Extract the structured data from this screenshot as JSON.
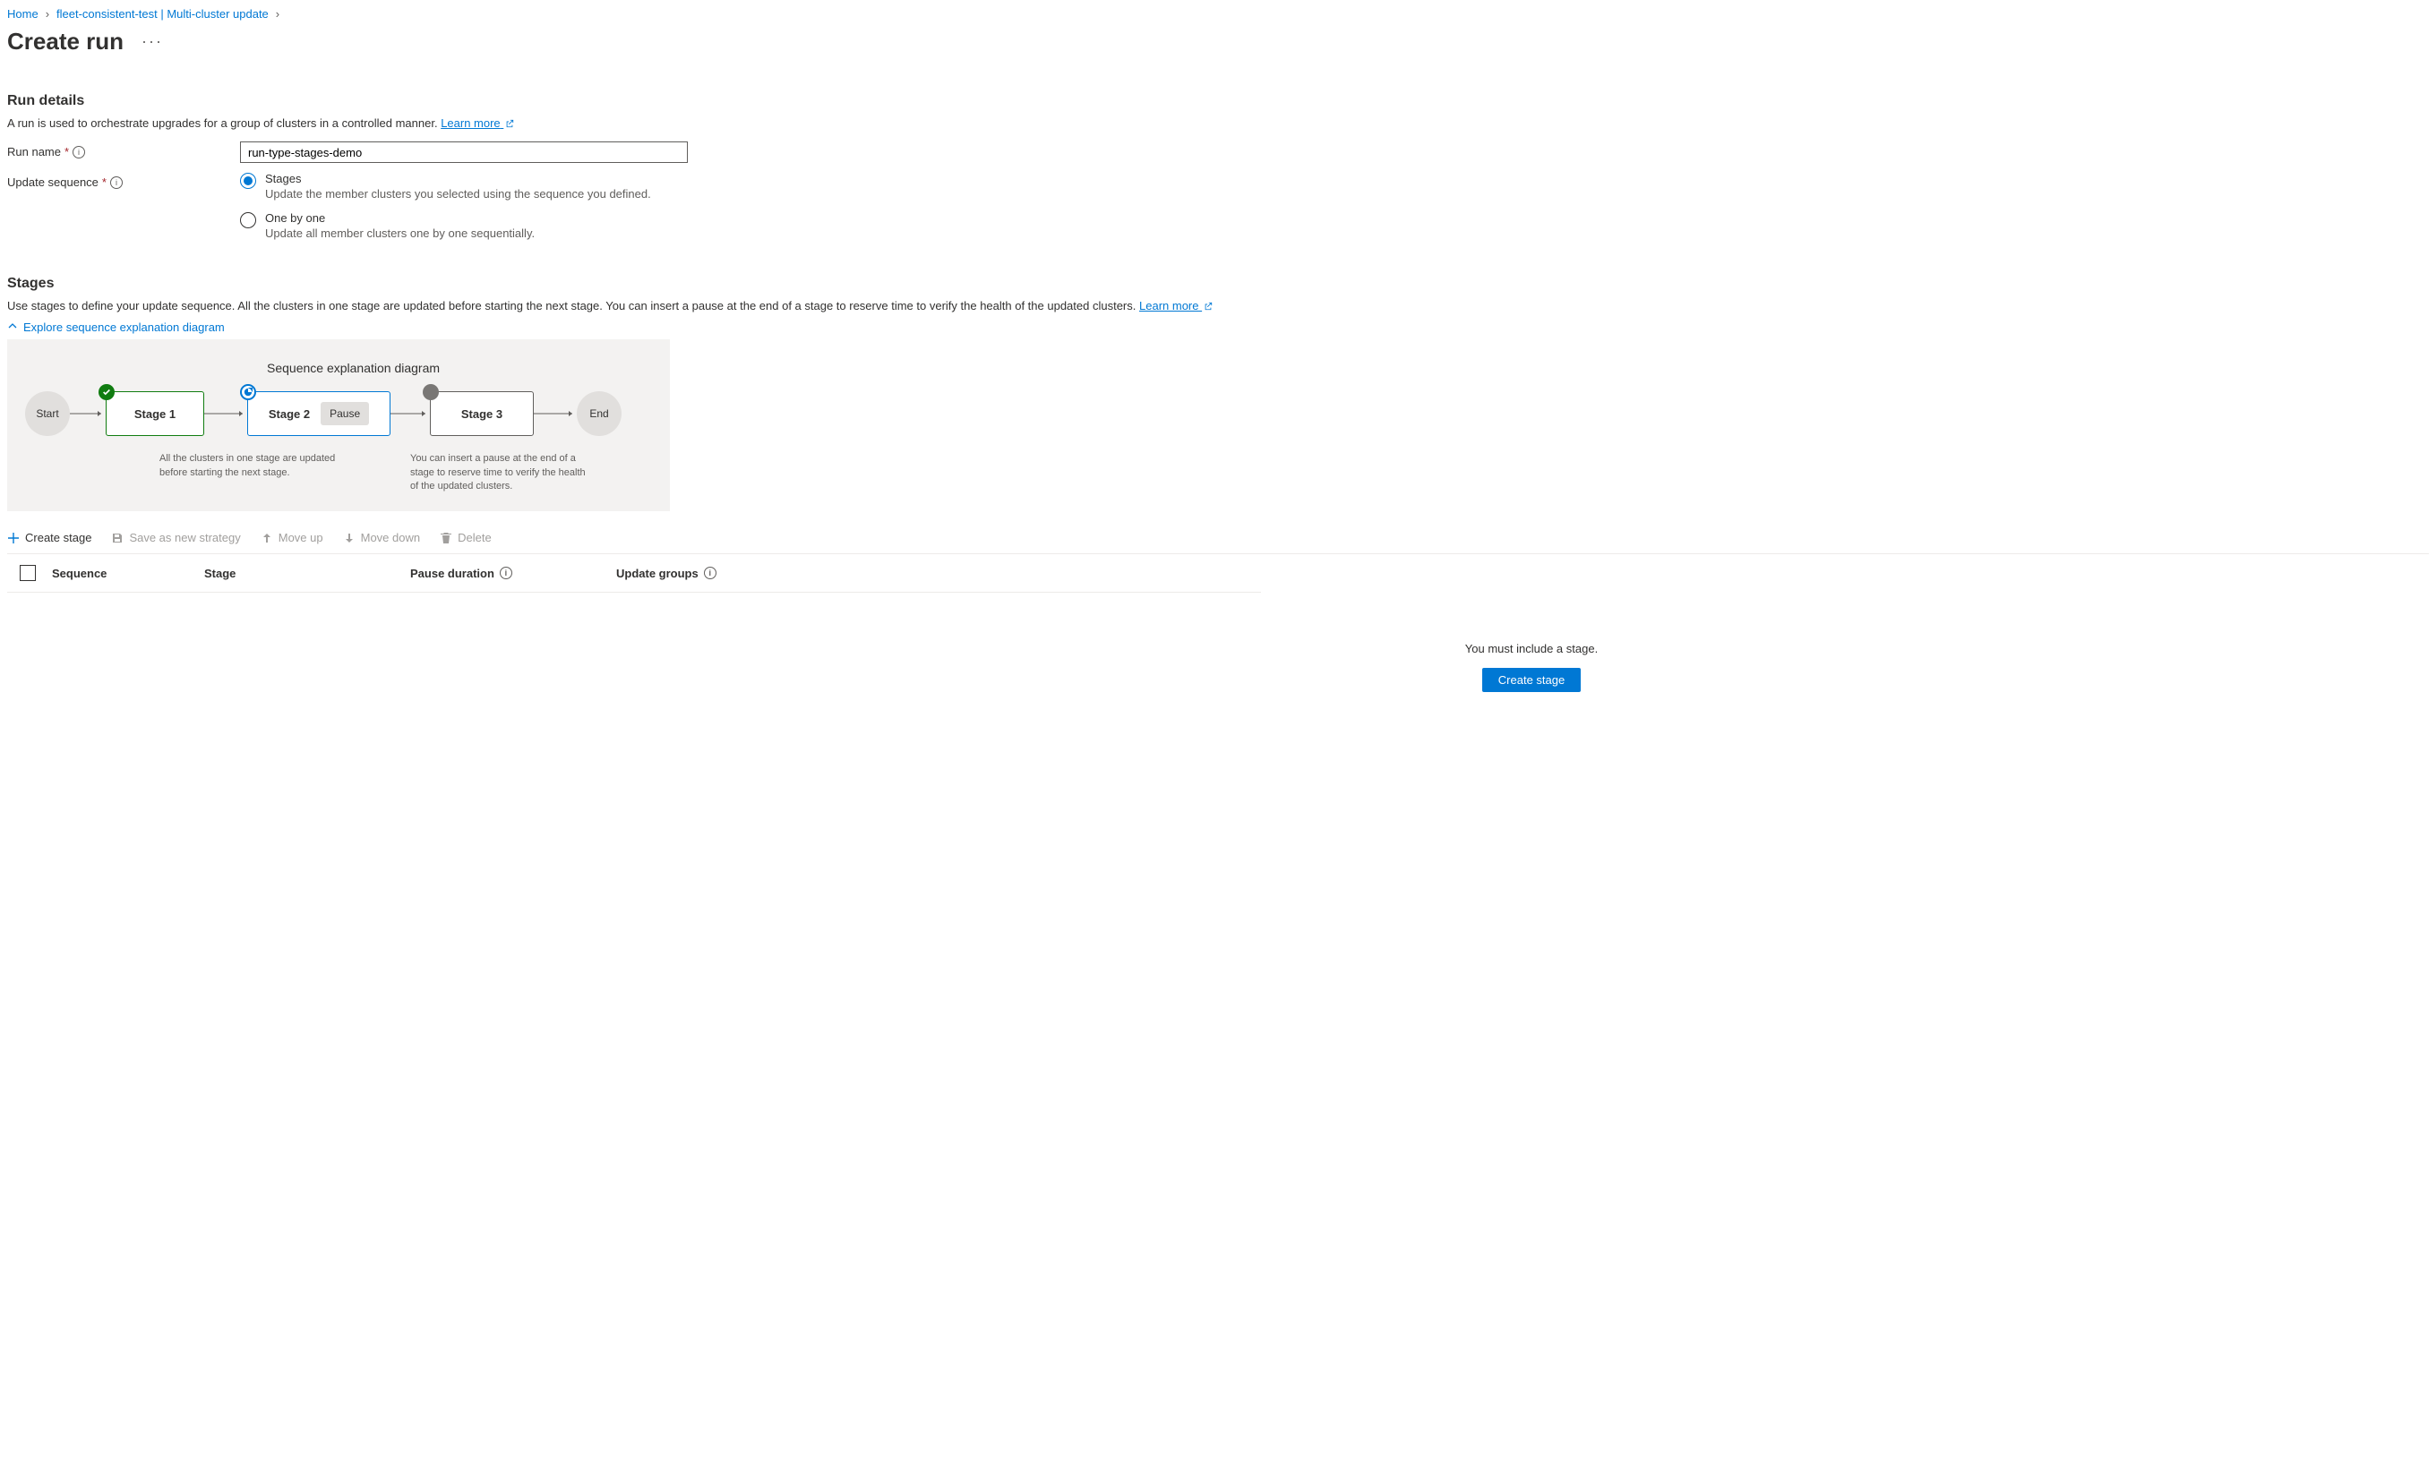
{
  "breadcrumb": {
    "home": "Home",
    "parent": "fleet-consistent-test | Multi-cluster update"
  },
  "page_title": "Create run",
  "run_details": {
    "heading": "Run details",
    "description": "A run is used to orchestrate upgrades for a group of clusters in a controlled manner.",
    "learn_more": "Learn more",
    "run_name_label": "Run name",
    "run_name_value": "run-type-stages-demo",
    "update_sequence_label": "Update sequence",
    "options": {
      "stages": {
        "label": "Stages",
        "desc": "Update the member clusters you selected using the sequence you defined."
      },
      "one_by_one": {
        "label": "One by one",
        "desc": "Update all member clusters one by one sequentially."
      }
    }
  },
  "stages": {
    "heading": "Stages",
    "description": "Use stages to define your update sequence. All the clusters in one stage are updated before starting the next stage. You can insert a pause at the end of a stage to reserve time to verify the health of the updated clusters.",
    "learn_more": "Learn more",
    "explore_toggle": "Explore sequence explanation diagram"
  },
  "diagram": {
    "title": "Sequence explanation diagram",
    "start": "Start",
    "stage1": "Stage 1",
    "stage2": "Stage 2",
    "pause": "Pause",
    "stage3": "Stage 3",
    "end": "End",
    "caption1": "All the clusters in one stage are updated before starting the next stage.",
    "caption2": "You can insert a pause at the end of a stage to reserve time to verify the health of the updated clusters."
  },
  "toolbar": {
    "create_stage": "Create stage",
    "save_strategy": "Save as new strategy",
    "move_up": "Move up",
    "move_down": "Move down",
    "delete": "Delete"
  },
  "table": {
    "headers": {
      "sequence": "Sequence",
      "stage": "Stage",
      "pause_duration": "Pause duration",
      "update_groups": "Update groups"
    }
  },
  "empty": {
    "message": "You must include a stage.",
    "button": "Create stage"
  }
}
